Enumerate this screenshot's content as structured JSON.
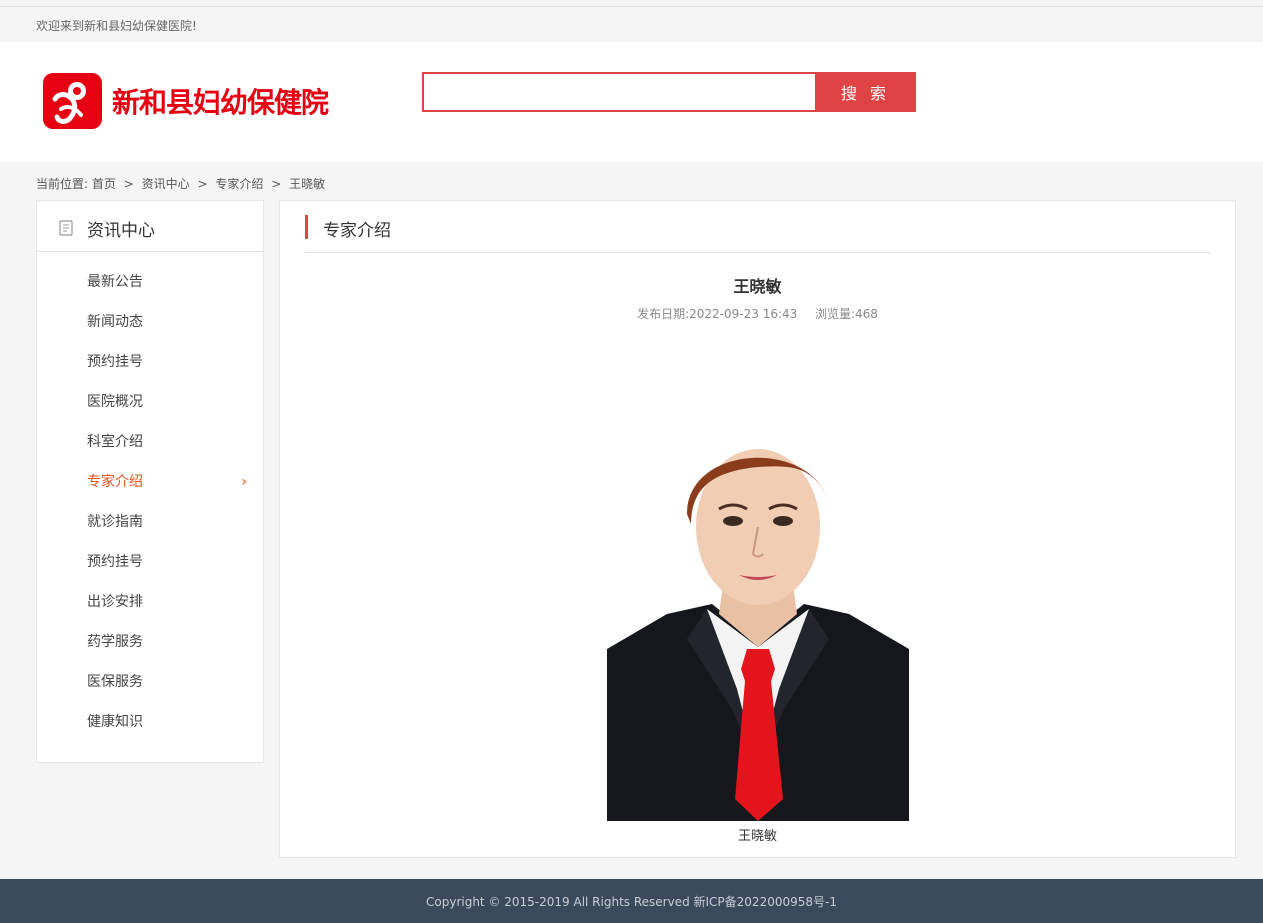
{
  "topbar": {
    "welcome": "欢迎来到新和县妇幼保健医院!"
  },
  "header": {
    "logo_text": "新和县妇幼保健院",
    "brand_color": "#e60012",
    "search": {
      "value": "",
      "placeholder": "",
      "button_label": "搜 索"
    }
  },
  "breadcrumb": {
    "prefix": "当前位置:",
    "items": [
      "首页",
      "资讯中心",
      "专家介绍",
      "王晓敏"
    ],
    "separator": ">"
  },
  "sidebar": {
    "title": "资讯中心",
    "items": [
      {
        "label": "最新公告"
      },
      {
        "label": "新闻动态"
      },
      {
        "label": "预约挂号"
      },
      {
        "label": "医院概况"
      },
      {
        "label": "科室介绍"
      },
      {
        "label": "专家介绍",
        "active": true,
        "chevron": "›"
      },
      {
        "label": "就诊指南"
      },
      {
        "label": "预约挂号"
      },
      {
        "label": "出诊安排"
      },
      {
        "label": "药学服务"
      },
      {
        "label": "医保服务"
      },
      {
        "label": "健康知识"
      }
    ]
  },
  "main": {
    "section_title": "专家介绍",
    "article": {
      "title": "王晓敏",
      "date_label": "发布日期:",
      "date": "2022-09-23 16:43",
      "views_label": "浏览量:",
      "views": "468",
      "caption": "王晓敏"
    }
  },
  "footer": {
    "copyright": "Copyright © 2015-2019 All Rights Reserved 新ICP备2022000958号-1"
  },
  "colors": {
    "accent": "#e04343",
    "active": "#e8541e",
    "footer_bg": "#3a4a5c"
  }
}
